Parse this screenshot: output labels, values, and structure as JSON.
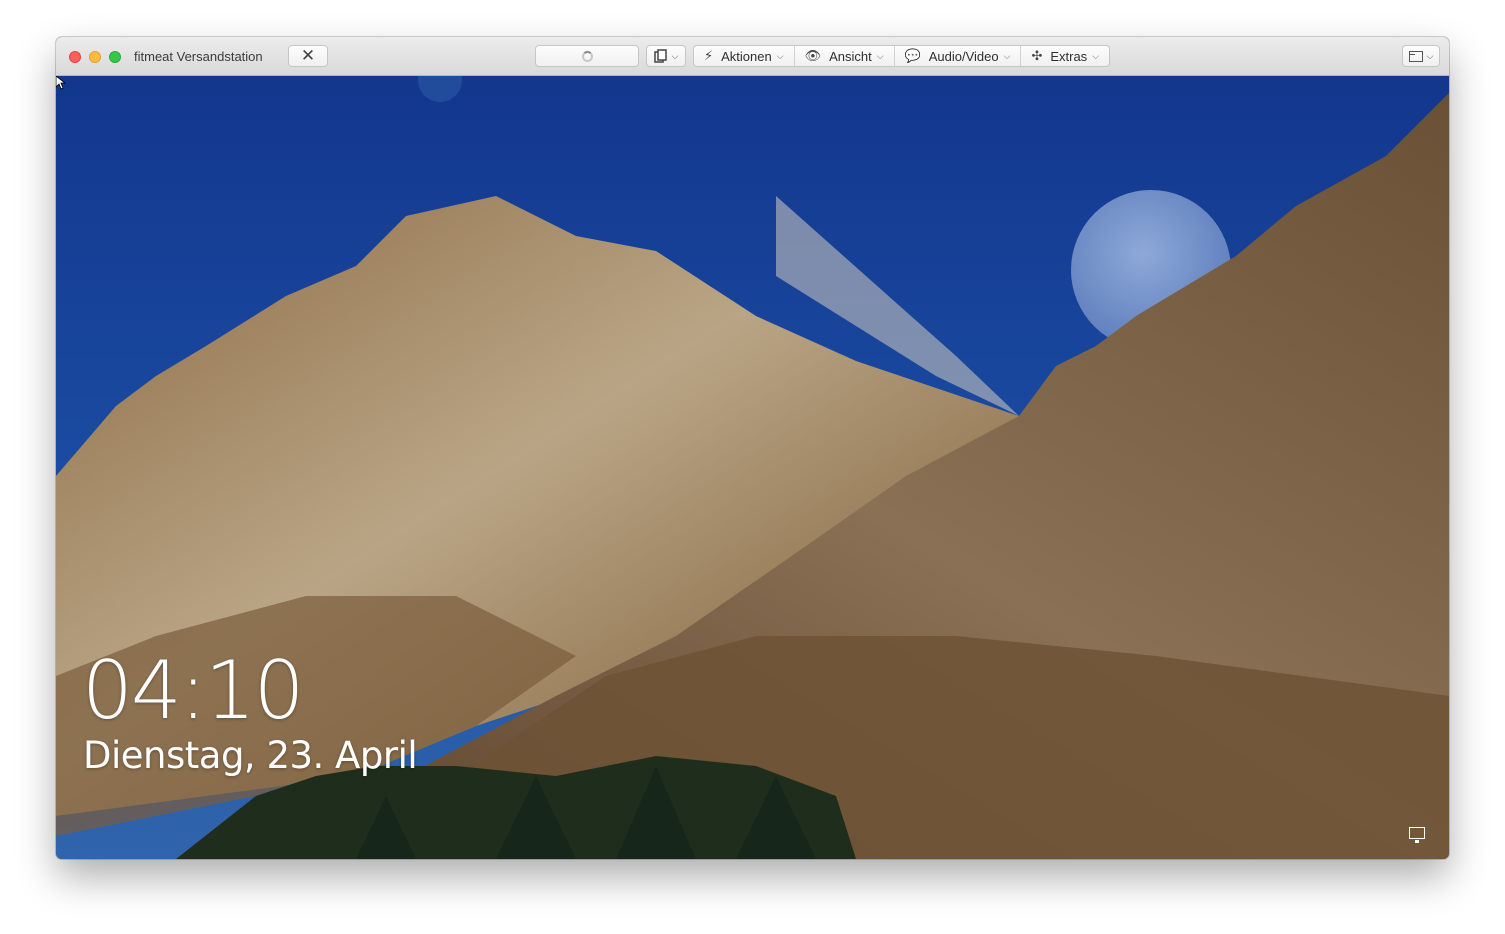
{
  "window": {
    "title": "fitmeat Versandstation",
    "disconnect_icon": "close-x-icon"
  },
  "toolbar": {
    "menus": [
      {
        "label": "Aktionen",
        "icon": "lightning-icon"
      },
      {
        "label": "Ansicht",
        "icon": "eye-icon"
      },
      {
        "label": "Audio/Video",
        "icon": "chat-bubbles-icon"
      },
      {
        "label": "Extras",
        "icon": "puzzle-icon"
      }
    ],
    "copy_icon": "copy-documents-icon",
    "layout_icon": "window-layout-icon",
    "loading_icon": "spinner-icon"
  },
  "lockscreen": {
    "time": "04:10",
    "date": "Dienstag, 23. April",
    "network_icon": "network-monitor-icon"
  },
  "colors": {
    "sky": "#1c4da3",
    "close": "#fc605c",
    "minimize": "#fdbc40",
    "maximize": "#34c84a"
  }
}
